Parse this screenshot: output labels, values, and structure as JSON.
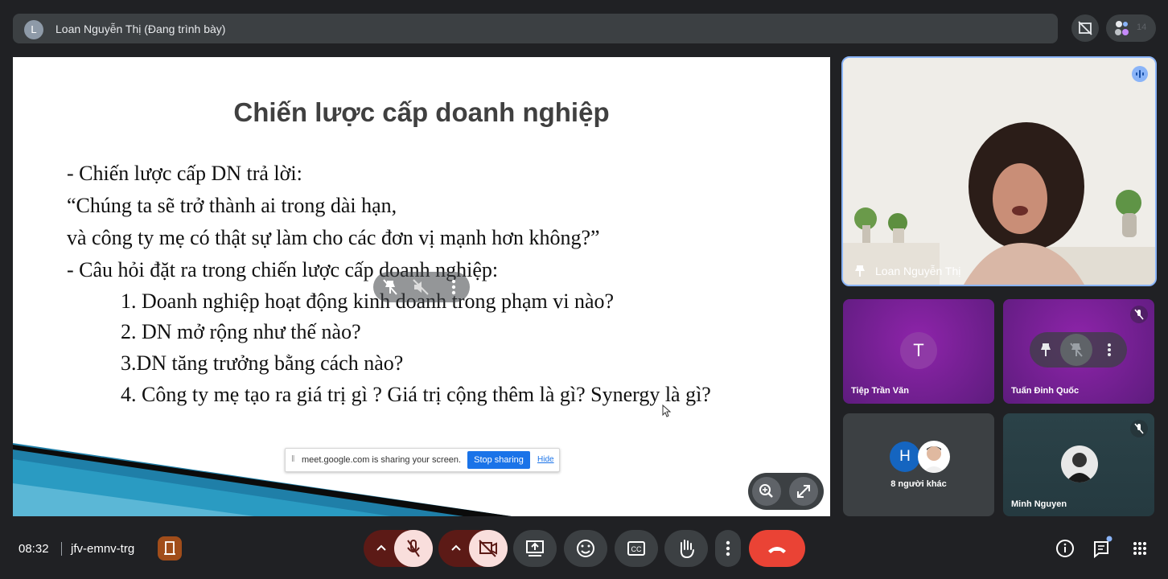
{
  "top_bar": {
    "presenter_initial": "L",
    "presenter_label": "Loan Nguyễn Thị (Đang trình bày)",
    "participant_count": "14"
  },
  "slide": {
    "title": "Chiến lược cấp doanh nghiệp",
    "lines": [
      "- Chiến lược cấp DN trả lời:",
      "“Chúng ta sẽ trở thành ai trong dài hạn,",
      "và công ty mẹ có thật sự làm cho các đơn vị mạnh hơn không?”",
      "- Câu hỏi đặt ra trong chiến lược cấp doanh nghiệp:",
      "1. Doanh nghiệp hoạt động kinh doanh trong phạm vi nào?",
      "2. DN mở rộng như thế nào?",
      "3.DN tăng trưởng bằng cách nào?",
      "4. Công ty mẹ tạo ra giá trị gì ? Giá trị cộng thêm là gì? Synergy là gì?"
    ]
  },
  "share_banner": {
    "text": "meet.google.com is sharing your screen.",
    "stop_label": "Stop sharing",
    "hide_label": "Hide"
  },
  "tiles": {
    "main_name": "Loan Nguyễn Thị",
    "t1_initial": "T",
    "t1_name": "Tiệp Trần Văn",
    "t2_name": "Tuấn Đinh Quốc",
    "t3_initial": "H",
    "t3_label": "8 người khác",
    "t4_name": "Minh Nguyen"
  },
  "bottom_bar": {
    "clock": "08:32",
    "meeting_code": "jfv-emnv-trg"
  },
  "colors": {
    "background": "#202124",
    "accent_blue": "#8ab4f8",
    "end_call": "#ea4335",
    "tile_purple": "#7b1fa2"
  },
  "icons": [
    "participants-icon",
    "pin-icon",
    "mic-off-icon",
    "camera-off-icon",
    "present-icon",
    "emoji-icon",
    "captions-icon",
    "raise-hand-icon",
    "more-icon",
    "end-call-icon",
    "info-icon",
    "chat-icon",
    "apps-icon",
    "zoom-in-icon",
    "fullscreen-icon"
  ]
}
